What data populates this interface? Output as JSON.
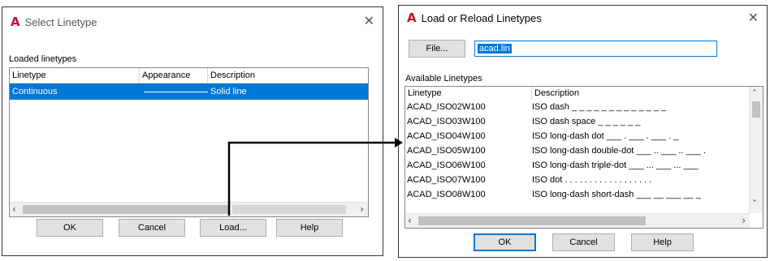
{
  "select_dialog": {
    "title": "Select Linetype",
    "close_glyph": "✕",
    "section_label": "Loaded linetypes",
    "columns": [
      "Linetype",
      "Appearance",
      "Description"
    ],
    "rows": [
      {
        "linetype": "Continuous",
        "description": "Solid line"
      }
    ],
    "buttons": {
      "ok": "OK",
      "cancel": "Cancel",
      "load": "Load...",
      "help": "Help"
    }
  },
  "load_dialog": {
    "title": "Load or Reload Linetypes",
    "close_glyph": "✕",
    "file_button": "File...",
    "file_name": "acad.lin",
    "section_label": "Available Linetypes",
    "columns": [
      "Linetype",
      "Description"
    ],
    "rows": [
      {
        "linetype": "ACAD_ISO02W100",
        "description": "ISO dash _ _ _ _ _ _ _ _ _ _ _ _ _"
      },
      {
        "linetype": "ACAD_ISO03W100",
        "description": "ISO dash space _   _   _   _   _   _"
      },
      {
        "linetype": "ACAD_ISO04W100",
        "description": "ISO long-dash dot ___ . ___ . ___ . _"
      },
      {
        "linetype": "ACAD_ISO05W100",
        "description": "ISO long-dash double-dot ___ .. ___ .. ___ ."
      },
      {
        "linetype": "ACAD_ISO06W100",
        "description": "ISO long-dash triple-dot ___ ... ___ ... ___"
      },
      {
        "linetype": "ACAD_ISO07W100",
        "description": "ISO dot . . . . . . . . . . . . . . . . . ."
      },
      {
        "linetype": "ACAD_ISO08W100",
        "description": "ISO long-dash short-dash ___ __ ___ __ _"
      }
    ],
    "buttons": {
      "ok": "OK",
      "cancel": "Cancel",
      "help": "Help"
    }
  },
  "colors": {
    "accent": "#0078d7",
    "logo": "#c8102e"
  },
  "icons": {
    "logo": "autocad-a-icon",
    "scroll_left": "chevron-left-icon",
    "scroll_right": "chevron-right-icon",
    "scroll_up": "chevron-up-icon",
    "scroll_down": "chevron-down-icon"
  }
}
